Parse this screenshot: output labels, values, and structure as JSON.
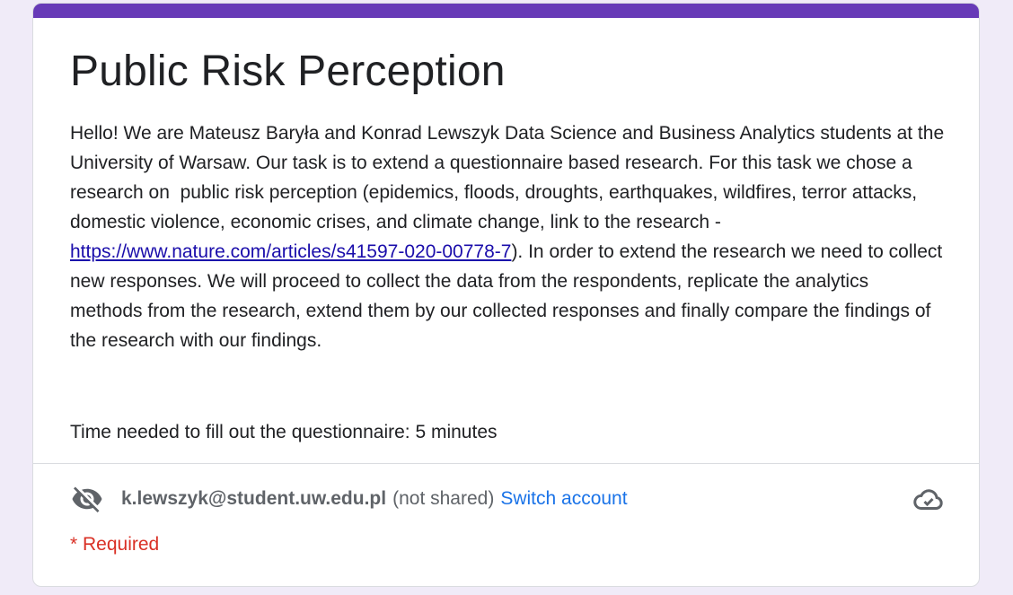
{
  "form": {
    "title": "Public Risk Perception",
    "description_part1": "Hello! We are Mateusz Baryła and Konrad Lewszyk Data Science and Business Analytics students at the University of Warsaw. Our task is to extend a questionnaire based research. For this task we chose a research on  public risk perception (epidemics, floods, droughts, earthquakes, wildfires, terror attacks, domestic violence, economic crises, and climate change, link to the research - ",
    "description_link": "https://www.nature.com/articles/s41597-020-00778-7",
    "description_part2": "). In order to extend the research we need to collect new responses. We will proceed to collect the data from the respondents, replicate the analytics methods from the research, extend them by our collected responses and finally compare the findings of the research with our findings.",
    "time_note": "Time needed to fill out the questionnaire: 5 minutes",
    "accent_color": "#673ab7"
  },
  "account": {
    "email": "k.lewszyk@student.uw.edu.pl",
    "not_shared": "(not shared)",
    "switch_account": "Switch account",
    "privacy_icon": "eye-off-icon",
    "save_icon": "cloud-check-icon"
  },
  "required_note": "* Required"
}
